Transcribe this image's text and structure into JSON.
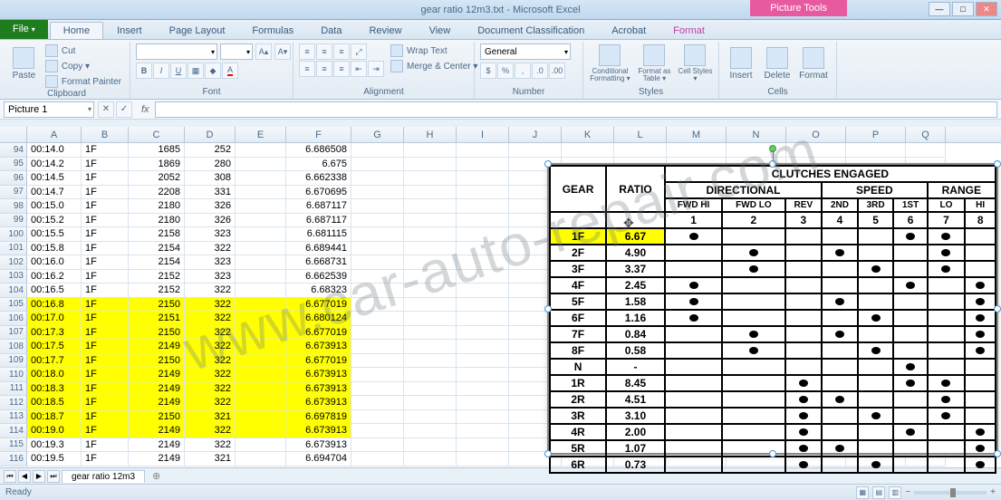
{
  "window": {
    "title": "gear ratio 12m3.txt - Microsoft Excel",
    "picture_tools": "Picture Tools"
  },
  "tabs": {
    "file": "File",
    "items": [
      "Home",
      "Insert",
      "Page Layout",
      "Formulas",
      "Data",
      "Review",
      "View",
      "Document Classification",
      "Acrobat"
    ],
    "format": "Format",
    "active_index": 0
  },
  "ribbon": {
    "clipboard": {
      "label": "Clipboard",
      "paste": "Paste",
      "cut": "Cut",
      "copy": "Copy ▾",
      "painter": "Format Painter"
    },
    "font": {
      "label": "Font",
      "family": "",
      "size": ""
    },
    "alignment": {
      "label": "Alignment",
      "wrap": "Wrap Text",
      "merge": "Merge & Center ▾"
    },
    "number": {
      "label": "Number",
      "format": "General"
    },
    "styles": {
      "label": "Styles",
      "cond": "Conditional Formatting ▾",
      "table": "Format as Table ▾",
      "cell": "Cell Styles ▾"
    },
    "cells": {
      "label": "Cells",
      "insert": "Insert",
      "delete": "Delete",
      "format": "Format"
    }
  },
  "namebox": "Picture 1",
  "columns": [
    "A",
    "B",
    "C",
    "D",
    "E",
    "F",
    "G",
    "H",
    "I",
    "J",
    "K",
    "L",
    "M",
    "N",
    "O",
    "P",
    "Q"
  ],
  "col_classes": [
    "cA",
    "cB",
    "cC",
    "cD",
    "cE",
    "cF",
    "cG",
    "cH",
    "cI",
    "cJ",
    "cK",
    "cL",
    "cM",
    "cN",
    "cO",
    "cP",
    "cQ"
  ],
  "rows": [
    {
      "n": 94,
      "a": "00:14.0",
      "b": "1F",
      "c": "1685",
      "d": "252",
      "f": "6.686508",
      "y": false
    },
    {
      "n": 95,
      "a": "00:14.2",
      "b": "1F",
      "c": "1869",
      "d": "280",
      "f": "6.675",
      "y": false
    },
    {
      "n": 96,
      "a": "00:14.5",
      "b": "1F",
      "c": "2052",
      "d": "308",
      "f": "6.662338",
      "y": false
    },
    {
      "n": 97,
      "a": "00:14.7",
      "b": "1F",
      "c": "2208",
      "d": "331",
      "f": "6.670695",
      "y": false
    },
    {
      "n": 98,
      "a": "00:15.0",
      "b": "1F",
      "c": "2180",
      "d": "326",
      "f": "6.687117",
      "y": false
    },
    {
      "n": 99,
      "a": "00:15.2",
      "b": "1F",
      "c": "2180",
      "d": "326",
      "f": "6.687117",
      "y": false
    },
    {
      "n": 100,
      "a": "00:15.5",
      "b": "1F",
      "c": "2158",
      "d": "323",
      "f": "6.681115",
      "y": false
    },
    {
      "n": 101,
      "a": "00:15.8",
      "b": "1F",
      "c": "2154",
      "d": "322",
      "f": "6.689441",
      "y": false
    },
    {
      "n": 102,
      "a": "00:16.0",
      "b": "1F",
      "c": "2154",
      "d": "323",
      "f": "6.668731",
      "y": false
    },
    {
      "n": 103,
      "a": "00:16.2",
      "b": "1F",
      "c": "2152",
      "d": "323",
      "f": "6.662539",
      "y": false
    },
    {
      "n": 104,
      "a": "00:16.5",
      "b": "1F",
      "c": "2152",
      "d": "322",
      "f": "6.68323",
      "y": false
    },
    {
      "n": 105,
      "a": "00:16.8",
      "b": "1F",
      "c": "2150",
      "d": "322",
      "f": "6.677019",
      "y": true
    },
    {
      "n": 106,
      "a": "00:17.0",
      "b": "1F",
      "c": "2151",
      "d": "322",
      "f": "6.680124",
      "y": true
    },
    {
      "n": 107,
      "a": "00:17.3",
      "b": "1F",
      "c": "2150",
      "d": "322",
      "f": "6.677019",
      "y": true
    },
    {
      "n": 108,
      "a": "00:17.5",
      "b": "1F",
      "c": "2149",
      "d": "322",
      "f": "6.673913",
      "y": true
    },
    {
      "n": 109,
      "a": "00:17.7",
      "b": "1F",
      "c": "2150",
      "d": "322",
      "f": "6.677019",
      "y": true
    },
    {
      "n": 110,
      "a": "00:18.0",
      "b": "1F",
      "c": "2149",
      "d": "322",
      "f": "6.673913",
      "y": true
    },
    {
      "n": 111,
      "a": "00:18.3",
      "b": "1F",
      "c": "2149",
      "d": "322",
      "f": "6.673913",
      "y": true
    },
    {
      "n": 112,
      "a": "00:18.5",
      "b": "1F",
      "c": "2149",
      "d": "322",
      "f": "6.673913",
      "y": true
    },
    {
      "n": 113,
      "a": "00:18.7",
      "b": "1F",
      "c": "2150",
      "d": "321",
      "f": "6.697819",
      "y": true
    },
    {
      "n": 114,
      "a": "00:19.0",
      "b": "1F",
      "c": "2149",
      "d": "322",
      "f": "6.673913",
      "y": true
    },
    {
      "n": 115,
      "a": "00:19.3",
      "b": "1F",
      "c": "2149",
      "d": "322",
      "f": "6.673913",
      "y": false
    },
    {
      "n": 116,
      "a": "00:19.5",
      "b": "1F",
      "c": "2149",
      "d": "321",
      "f": "6.694704",
      "y": false
    }
  ],
  "picture": {
    "title": "CLUTCHES ENGAGED",
    "group1": "DIRECTIONAL",
    "group2": "SPEED",
    "group3": "RANGE",
    "gear": "GEAR",
    "ratio": "RATIO",
    "cols": [
      "FWD HI",
      "FWD LO",
      "REV",
      "2ND",
      "3RD",
      "1ST",
      "LO",
      "HI"
    ],
    "nums": [
      "1",
      "2",
      "3",
      "4",
      "5",
      "6",
      "7",
      "8"
    ],
    "data": [
      {
        "g": "1F",
        "r": "6.67",
        "d": [
          1,
          0,
          0,
          0,
          0,
          1,
          1,
          0
        ],
        "hl": true
      },
      {
        "g": "2F",
        "r": "4.90",
        "d": [
          0,
          1,
          0,
          1,
          0,
          0,
          1,
          0
        ]
      },
      {
        "g": "3F",
        "r": "3.37",
        "d": [
          0,
          1,
          0,
          0,
          1,
          0,
          1,
          0
        ]
      },
      {
        "g": "4F",
        "r": "2.45",
        "d": [
          1,
          0,
          0,
          0,
          0,
          1,
          0,
          1
        ]
      },
      {
        "g": "5F",
        "r": "1.58",
        "d": [
          1,
          0,
          0,
          1,
          0,
          0,
          0,
          1
        ]
      },
      {
        "g": "6F",
        "r": "1.16",
        "d": [
          1,
          0,
          0,
          0,
          1,
          0,
          0,
          1
        ]
      },
      {
        "g": "7F",
        "r": "0.84",
        "d": [
          0,
          1,
          0,
          1,
          0,
          0,
          0,
          1
        ]
      },
      {
        "g": "8F",
        "r": "0.58",
        "d": [
          0,
          1,
          0,
          0,
          1,
          0,
          0,
          1
        ]
      },
      {
        "g": "N",
        "r": "-",
        "d": [
          0,
          0,
          0,
          0,
          0,
          1,
          0,
          0
        ]
      },
      {
        "g": "1R",
        "r": "8.45",
        "d": [
          0,
          0,
          1,
          0,
          0,
          1,
          1,
          0
        ]
      },
      {
        "g": "2R",
        "r": "4.51",
        "d": [
          0,
          0,
          1,
          1,
          0,
          0,
          1,
          0
        ]
      },
      {
        "g": "3R",
        "r": "3.10",
        "d": [
          0,
          0,
          1,
          0,
          1,
          0,
          1,
          0
        ]
      },
      {
        "g": "4R",
        "r": "2.00",
        "d": [
          0,
          0,
          1,
          0,
          0,
          1,
          0,
          1
        ]
      },
      {
        "g": "5R",
        "r": "1.07",
        "d": [
          0,
          0,
          1,
          1,
          0,
          0,
          0,
          1
        ]
      },
      {
        "g": "6R",
        "r": "0.73",
        "d": [
          0,
          0,
          1,
          0,
          1,
          0,
          0,
          1
        ]
      }
    ]
  },
  "sheet": {
    "name": "gear ratio 12m3"
  },
  "status": {
    "ready": "Ready"
  },
  "watermark": "www.car-auto-repair.com"
}
